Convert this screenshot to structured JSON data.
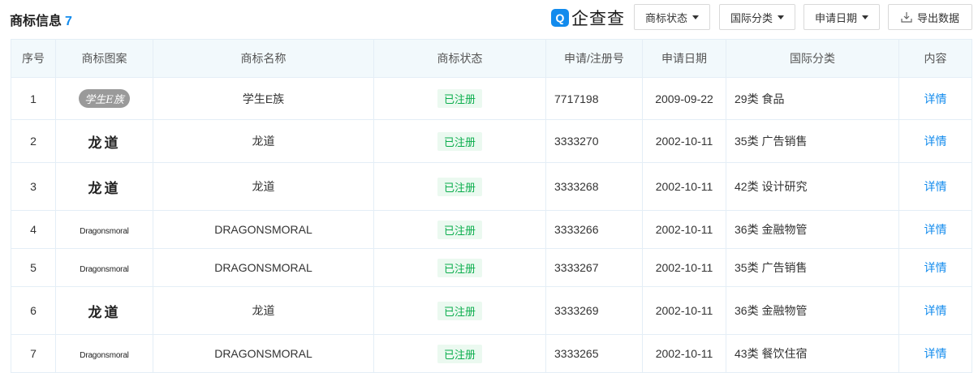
{
  "header": {
    "title": "商标信息",
    "count": "7",
    "brand_logo_glyph": "Q",
    "brand_text": "企查查",
    "filters": [
      {
        "label": "商标状态"
      },
      {
        "label": "国际分类"
      },
      {
        "label": "申请日期"
      }
    ],
    "export_label": "导出数据"
  },
  "table": {
    "columns": [
      "序号",
      "商标图案",
      "商标名称",
      "商标状态",
      "申请/注册号",
      "申请日期",
      "国际分类",
      "内容"
    ],
    "rows": [
      {
        "index": "1",
        "logo_text": "学生E族",
        "logo_style": "badge",
        "name": "学生E族",
        "status": "已注册",
        "reg_no": "7717198",
        "date": "2009-09-22",
        "class": "29类 食品",
        "detail": "详情"
      },
      {
        "index": "2",
        "logo_text": "龙道",
        "logo_style": "calligraphy",
        "name": "龙道",
        "status": "已注册",
        "reg_no": "3333270",
        "date": "2002-10-11",
        "class": "35类 广告销售",
        "detail": "详情"
      },
      {
        "index": "3",
        "logo_text": "龙道",
        "logo_style": "calligraphy",
        "name": "龙道",
        "status": "已注册",
        "reg_no": "3333268",
        "date": "2002-10-11",
        "class": "42类 设计研究",
        "detail": "详情"
      },
      {
        "index": "4",
        "logo_text": "Dragonsmoral",
        "logo_style": "script",
        "name": "DRAGONSMORAL",
        "status": "已注册",
        "reg_no": "3333266",
        "date": "2002-10-11",
        "class": "36类 金融物管",
        "detail": "详情"
      },
      {
        "index": "5",
        "logo_text": "Dragonsmoral",
        "logo_style": "script",
        "name": "DRAGONSMORAL",
        "status": "已注册",
        "reg_no": "3333267",
        "date": "2002-10-11",
        "class": "35类 广告销售",
        "detail": "详情"
      },
      {
        "index": "6",
        "logo_text": "龙道",
        "logo_style": "calligraphy",
        "name": "龙道",
        "status": "已注册",
        "reg_no": "3333269",
        "date": "2002-10-11",
        "class": "36类 金融物管",
        "detail": "详情"
      },
      {
        "index": "7",
        "logo_text": "Dragonsmoral",
        "logo_style": "script",
        "name": "DRAGONSMORAL",
        "status": "已注册",
        "reg_no": "3333265",
        "date": "2002-10-11",
        "class": "43类 餐饮住宿",
        "detail": "详情"
      }
    ]
  },
  "colors": {
    "accent": "#128bed",
    "status_green": "#0aad4c",
    "status_bg": "#ebf9f0",
    "header_bg": "#f2f9fc"
  },
  "icons": {
    "caret": "caret-down-icon",
    "download": "download-icon"
  }
}
